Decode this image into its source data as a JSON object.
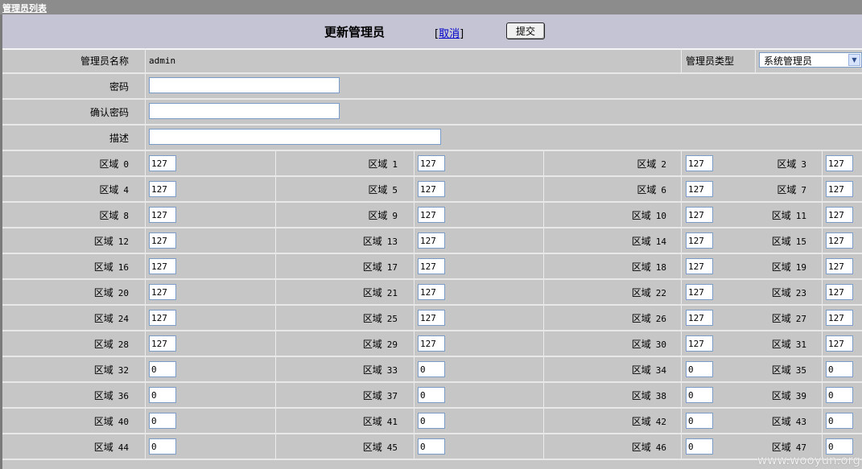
{
  "window": {
    "tab_link": "管理员列表"
  },
  "form": {
    "title": "更新管理员",
    "cancel_bracket_open": "[",
    "cancel_label": "取消",
    "cancel_bracket_close": "]",
    "submit_label": "提交",
    "name_label": "管理员名称",
    "name_value": "admin",
    "type_label": "管理员类型",
    "type_value": "系统管理员",
    "password_label": "密码",
    "password_value": "",
    "confirm_label": "确认密码",
    "confirm_value": "",
    "desc_label": "描述",
    "desc_value": ""
  },
  "regions": {
    "label_prefix": "区域",
    "items": [
      {
        "n": "0",
        "v": "127"
      },
      {
        "n": "1",
        "v": "127"
      },
      {
        "n": "2",
        "v": "127"
      },
      {
        "n": "3",
        "v": "127"
      },
      {
        "n": "4",
        "v": "127"
      },
      {
        "n": "5",
        "v": "127"
      },
      {
        "n": "6",
        "v": "127"
      },
      {
        "n": "7",
        "v": "127"
      },
      {
        "n": "8",
        "v": "127"
      },
      {
        "n": "9",
        "v": "127"
      },
      {
        "n": "10",
        "v": "127"
      },
      {
        "n": "11",
        "v": "127"
      },
      {
        "n": "12",
        "v": "127"
      },
      {
        "n": "13",
        "v": "127"
      },
      {
        "n": "14",
        "v": "127"
      },
      {
        "n": "15",
        "v": "127"
      },
      {
        "n": "16",
        "v": "127"
      },
      {
        "n": "17",
        "v": "127"
      },
      {
        "n": "18",
        "v": "127"
      },
      {
        "n": "19",
        "v": "127"
      },
      {
        "n": "20",
        "v": "127"
      },
      {
        "n": "21",
        "v": "127"
      },
      {
        "n": "22",
        "v": "127"
      },
      {
        "n": "23",
        "v": "127"
      },
      {
        "n": "24",
        "v": "127"
      },
      {
        "n": "25",
        "v": "127"
      },
      {
        "n": "26",
        "v": "127"
      },
      {
        "n": "27",
        "v": "127"
      },
      {
        "n": "28",
        "v": "127"
      },
      {
        "n": "29",
        "v": "127"
      },
      {
        "n": "30",
        "v": "127"
      },
      {
        "n": "31",
        "v": "127"
      },
      {
        "n": "32",
        "v": "0"
      },
      {
        "n": "33",
        "v": "0"
      },
      {
        "n": "34",
        "v": "0"
      },
      {
        "n": "35",
        "v": "0"
      },
      {
        "n": "36",
        "v": "0"
      },
      {
        "n": "37",
        "v": "0"
      },
      {
        "n": "38",
        "v": "0"
      },
      {
        "n": "39",
        "v": "0"
      },
      {
        "n": "40",
        "v": "0"
      },
      {
        "n": "41",
        "v": "0"
      },
      {
        "n": "42",
        "v": "0"
      },
      {
        "n": "43",
        "v": "0"
      },
      {
        "n": "44",
        "v": "0"
      },
      {
        "n": "45",
        "v": "0"
      },
      {
        "n": "46",
        "v": "0"
      },
      {
        "n": "47",
        "v": "0"
      }
    ]
  },
  "watermark": "www.wooyun.org"
}
